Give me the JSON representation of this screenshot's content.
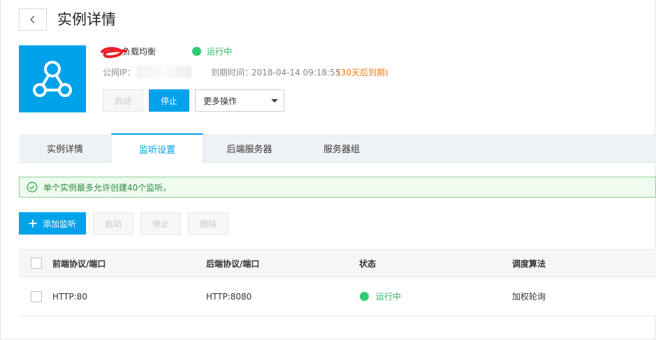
{
  "page": {
    "title": "实例详情"
  },
  "instance": {
    "name": "负载均衡",
    "status": "运行中",
    "ip_label": "公网IP：",
    "expire_label": "到期时间：",
    "expire_value": "2018-04-14 09:18:55",
    "expire_warning": "(30天后到期)"
  },
  "actions": {
    "start_label": "启动",
    "stop_label": "停止",
    "more_label": "更多操作"
  },
  "tabs": [
    {
      "label": "实例详情",
      "active": false
    },
    {
      "label": "监听设置",
      "active": true
    },
    {
      "label": "后端服务器",
      "active": false
    },
    {
      "label": "服务器组",
      "active": false
    }
  ],
  "notice": {
    "text": "单个实例最多允许创建40个监听。"
  },
  "toolbar": {
    "add_label": "添加监听",
    "start_label": "启动",
    "stop_label": "停止",
    "delete_label": "删除"
  },
  "table": {
    "columns": [
      "前端协议/端口",
      "后端协议/端口",
      "状态",
      "调度算法"
    ],
    "rows": [
      {
        "frontend": "HTTP:80",
        "backend": "HTTP:8080",
        "status": "运行中",
        "algorithm": "加权轮询"
      }
    ]
  },
  "colors": {
    "accent": "#00a2ea",
    "running": "#2ecc71",
    "warning": "#f37a0f",
    "notice_bg": "#f0fbf0"
  },
  "icons": {
    "back": "chevron-left-icon",
    "instance": "load-balancer-icon",
    "notice": "check-circle-icon",
    "add": "plus-icon",
    "select": "caret-down-icon"
  }
}
